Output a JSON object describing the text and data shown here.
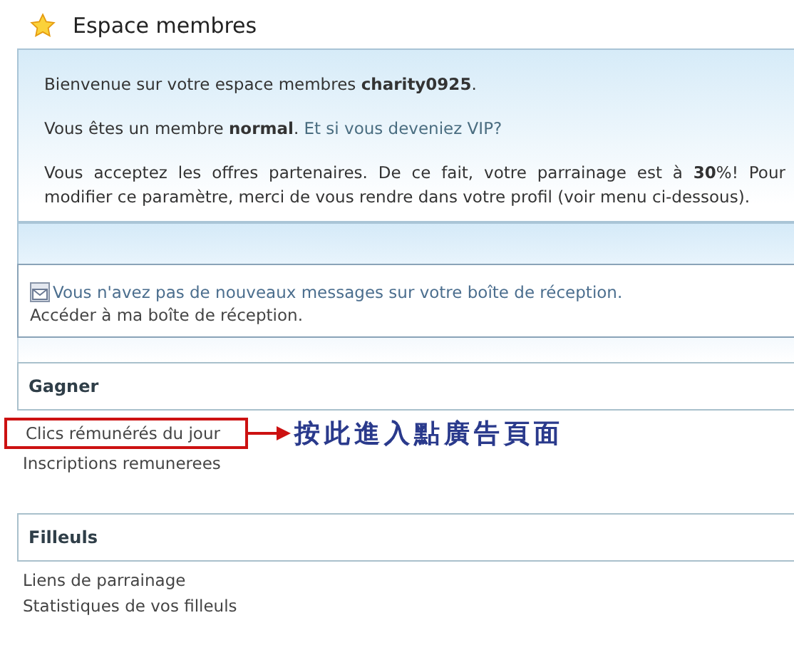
{
  "title": "Espace membres",
  "welcome": {
    "paragraphs": [
      {
        "text": "Bienvenue sur votre espace membres **charity0925**."
      },
      {
        "text": "Vous êtes un membre **normal**.",
        "link": "Et si vous deveniez VIP?"
      },
      {
        "text": "Vous acceptez les offres partenaires. De ce fait, votre parrainage est à **30**%! Pour modifier ce paramètre, merci de vous rendre dans votre profil (voir menu ci-dessous)."
      }
    ]
  },
  "messages": {
    "notice": "Vous n'avez pas de nouveaux messages sur votre boîte de réception.",
    "inbox_link": "Accéder à ma boîte de réception."
  },
  "sections": [
    {
      "heading": "Gagner",
      "links": [
        {
          "label": "Clics rémunérés du jour",
          "highlighted": true
        },
        {
          "label": "Inscriptions remunerees",
          "highlighted": false
        }
      ]
    },
    {
      "heading": "Filleuls",
      "links": [
        {
          "label": "Liens de parrainage",
          "highlighted": false
        },
        {
          "label": "Statistiques de vos filleuls",
          "highlighted": false
        }
      ]
    }
  ],
  "annotation": {
    "text": "按此進入點廣告頁面"
  }
}
